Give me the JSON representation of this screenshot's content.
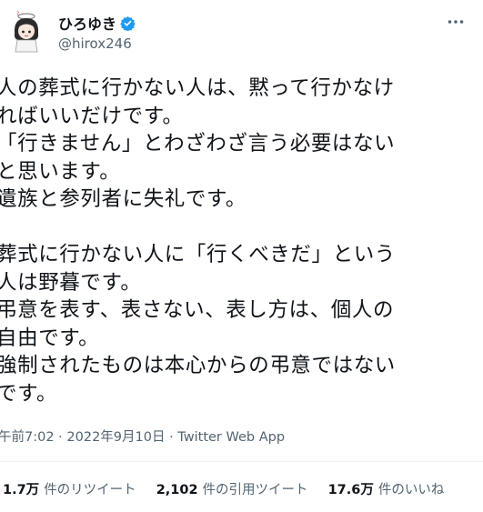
{
  "author": {
    "name": "ひろゆき",
    "handle": "@hirox246",
    "verified_color": "#1d9bf0"
  },
  "tweet": {
    "lines": [
      "人の葬式に行かない人は、黙って行かなけ",
      "ればいいだけです。",
      "「行きません」とわざわざ言う必要はない",
      "と思います。",
      "遺族と参列者に失礼です。",
      "",
      "葬式に行かない人に「行くべきだ」という",
      "人は野暮です。",
      "弔意を表す、表さない、表し方は、個人の",
      "自由です。",
      "強制されたものは本心からの弔意ではない",
      "です。"
    ]
  },
  "meta": {
    "time": "午前7:02",
    "separator1": " · ",
    "date": "2022年9月10日",
    "separator2": " · ",
    "app": "Twitter Web App"
  },
  "stats": {
    "retweets": {
      "count": "1.7万",
      "label": "件のリツイート"
    },
    "quotes": {
      "count": "2,102",
      "label": "件の引用ツイート"
    },
    "likes": {
      "count": "17.6万",
      "label": "件のいいね"
    }
  },
  "icons": {
    "more": "more-horizontal-icon",
    "verified": "verified-badge-icon"
  }
}
